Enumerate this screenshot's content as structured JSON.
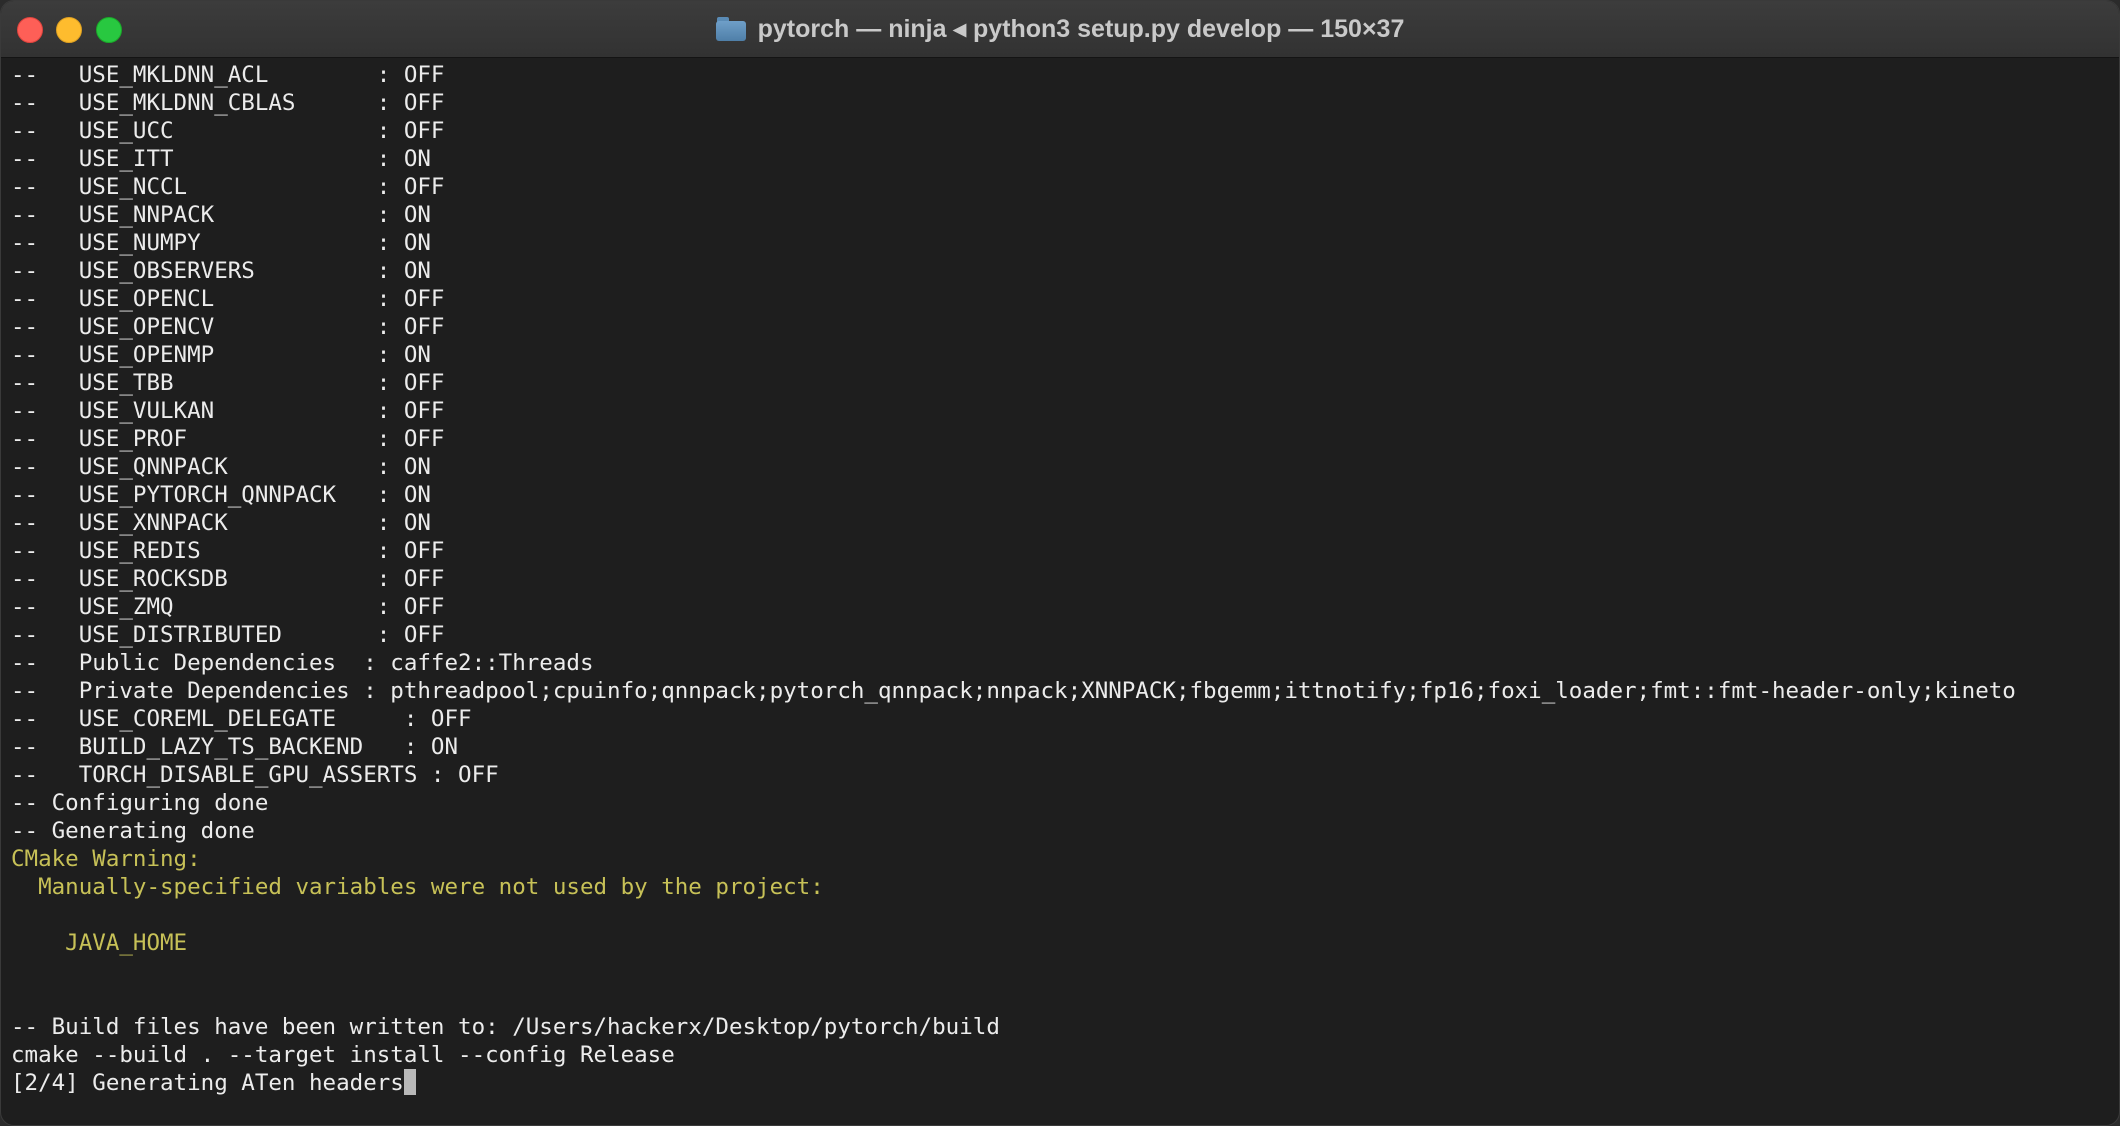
{
  "window": {
    "title": "pytorch — ninja ◂ python3 setup.py develop — 150×37",
    "folder_icon": "folder-icon",
    "buttons": {
      "close": "close",
      "minimize": "minimize",
      "zoom": "zoom"
    }
  },
  "terminal": {
    "lines": [
      {
        "text": "--   USE_MKLDNN_ACL        : OFF",
        "style": "normal"
      },
      {
        "text": "--   USE_MKLDNN_CBLAS      : OFF",
        "style": "normal"
      },
      {
        "text": "--   USE_UCC               : OFF",
        "style": "normal"
      },
      {
        "text": "--   USE_ITT               : ON",
        "style": "normal"
      },
      {
        "text": "--   USE_NCCL              : OFF",
        "style": "normal"
      },
      {
        "text": "--   USE_NNPACK            : ON",
        "style": "normal"
      },
      {
        "text": "--   USE_NUMPY             : ON",
        "style": "normal"
      },
      {
        "text": "--   USE_OBSERVERS         : ON",
        "style": "normal"
      },
      {
        "text": "--   USE_OPENCL            : OFF",
        "style": "normal"
      },
      {
        "text": "--   USE_OPENCV            : OFF",
        "style": "normal"
      },
      {
        "text": "--   USE_OPENMP            : ON",
        "style": "normal"
      },
      {
        "text": "--   USE_TBB               : OFF",
        "style": "normal"
      },
      {
        "text": "--   USE_VULKAN            : OFF",
        "style": "normal"
      },
      {
        "text": "--   USE_PROF              : OFF",
        "style": "normal"
      },
      {
        "text": "--   USE_QNNPACK           : ON",
        "style": "normal"
      },
      {
        "text": "--   USE_PYTORCH_QNNPACK   : ON",
        "style": "normal"
      },
      {
        "text": "--   USE_XNNPACK           : ON",
        "style": "normal"
      },
      {
        "text": "--   USE_REDIS             : OFF",
        "style": "normal"
      },
      {
        "text": "--   USE_ROCKSDB           : OFF",
        "style": "normal"
      },
      {
        "text": "--   USE_ZMQ               : OFF",
        "style": "normal"
      },
      {
        "text": "--   USE_DISTRIBUTED       : OFF",
        "style": "normal"
      },
      {
        "text": "--   Public Dependencies  : caffe2::Threads",
        "style": "normal"
      },
      {
        "text": "--   Private Dependencies : pthreadpool;cpuinfo;qnnpack;pytorch_qnnpack;nnpack;XNNPACK;fbgemm;ittnotify;fp16;foxi_loader;fmt::fmt-header-only;kineto",
        "style": "normal"
      },
      {
        "text": "--   USE_COREML_DELEGATE     : OFF",
        "style": "normal"
      },
      {
        "text": "--   BUILD_LAZY_TS_BACKEND   : ON",
        "style": "normal"
      },
      {
        "text": "--   TORCH_DISABLE_GPU_ASSERTS : OFF",
        "style": "normal"
      },
      {
        "text": "-- Configuring done",
        "style": "normal"
      },
      {
        "text": "-- Generating done",
        "style": "normal"
      },
      {
        "text": "CMake Warning:",
        "style": "warn"
      },
      {
        "text": "  Manually-specified variables were not used by the project:",
        "style": "warn"
      },
      {
        "text": "",
        "style": "warn"
      },
      {
        "text": "    JAVA_HOME",
        "style": "warn"
      },
      {
        "text": "",
        "style": "normal"
      },
      {
        "text": "",
        "style": "normal"
      },
      {
        "text": "-- Build files have been written to: /Users/hackerx/Desktop/pytorch/build",
        "style": "normal"
      },
      {
        "text": "cmake --build . --target install --config Release",
        "style": "normal"
      },
      {
        "text": "[2/4] Generating ATen headers",
        "style": "normal"
      }
    ],
    "colors": {
      "background": "#1e1e1e",
      "foreground": "#ececec",
      "warning": "#c7c157",
      "cursor": "#b8b8b8"
    }
  }
}
